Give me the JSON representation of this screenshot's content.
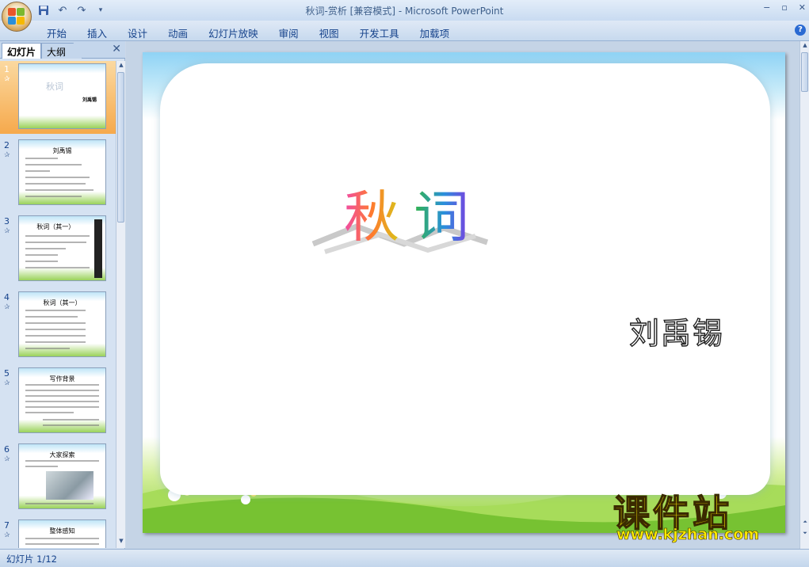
{
  "window": {
    "title": "秋词-赏析 [兼容模式] - Microsoft PowerPoint",
    "minimize": "−",
    "restore": "▫",
    "close": "✕"
  },
  "ribbon": {
    "tabs": [
      "开始",
      "插入",
      "设计",
      "动画",
      "幻灯片放映",
      "审阅",
      "视图",
      "开发工具",
      "加载项"
    ],
    "help": "?"
  },
  "qat": {
    "save": "save-icon",
    "undo": "undo-icon",
    "redo": "redo-icon"
  },
  "left_pane": {
    "tabs": {
      "slides": "幻灯片",
      "outline": "大纲"
    },
    "close": "✕",
    "slides": [
      {
        "num": "1",
        "title": "秋词",
        "sub": "刘禹锡"
      },
      {
        "num": "2",
        "title": "刘禹锡"
      },
      {
        "num": "3",
        "title": "秋词（其一）"
      },
      {
        "num": "4",
        "title": "秋词（其一）"
      },
      {
        "num": "5",
        "title": "写作背景"
      },
      {
        "num": "6",
        "title": "大家探索"
      },
      {
        "num": "7",
        "title": "整体感知"
      }
    ]
  },
  "slide": {
    "title_chars": [
      "秋",
      "词"
    ],
    "author": "刘禹锡"
  },
  "status": {
    "text": "幻灯片 1/12"
  },
  "watermark": {
    "cn": "课件站",
    "url": "www.kjzhan.com"
  }
}
